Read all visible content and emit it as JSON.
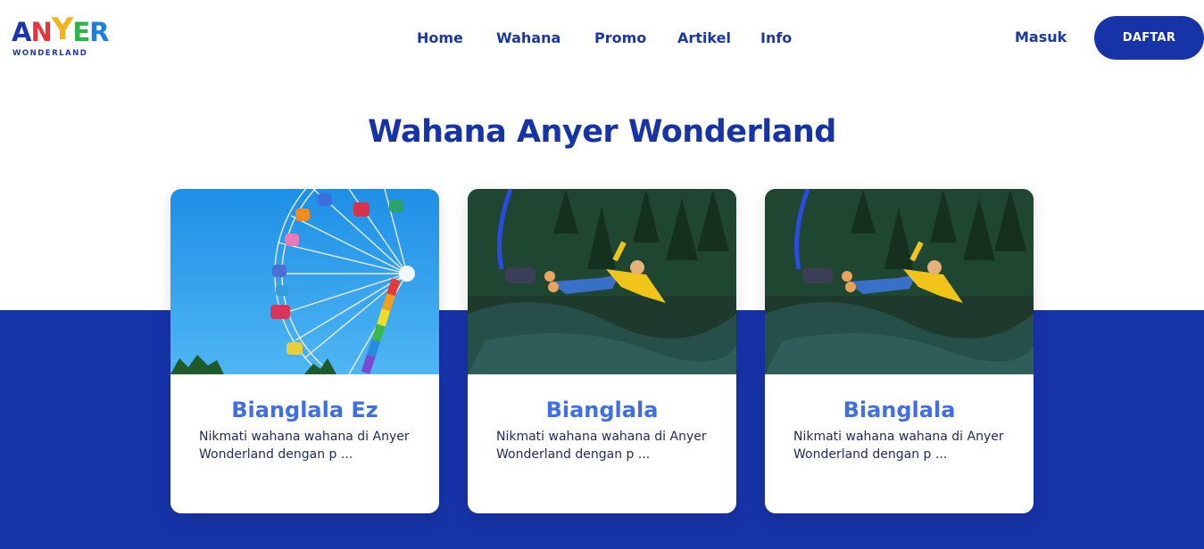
{
  "header": {
    "logo": {
      "letters": [
        {
          "char": "A",
          "color": "#1a37b0"
        },
        {
          "char": "N",
          "color": "#e8343a"
        },
        {
          "char": "Y",
          "color": "#f5b31f"
        },
        {
          "char": "E",
          "color": "#2db34a"
        },
        {
          "char": "R",
          "color": "#1a7fe0"
        }
      ],
      "subtitle": "WONDERLAND"
    },
    "nav": [
      "Home",
      "Wahana",
      "Promo",
      "Artikel",
      "Info"
    ],
    "login_label": "Masuk",
    "register_label": "DAFTAR"
  },
  "main": {
    "title": "Wahana Anyer Wonderland",
    "cards": [
      {
        "title": "Bianglala Ez",
        "description": "Nikmati wahana wahana di Anyer Wonderland dengan p ...",
        "image": "ferris-wheel-photo"
      },
      {
        "title": "Bianglala",
        "description": "Nikmati wahana wahana di Anyer Wonderland dengan p ...",
        "image": "bungee-jump-photo"
      },
      {
        "title": "Bianglala",
        "description": "Nikmati wahana wahana di Anyer Wonderland dengan p ...",
        "image": "bungee-jump-photo"
      }
    ]
  },
  "colors": {
    "primary": "#1733a8",
    "card_title": "#3f6fe3",
    "text": "#1d2a5a",
    "background": "#ffffff"
  }
}
